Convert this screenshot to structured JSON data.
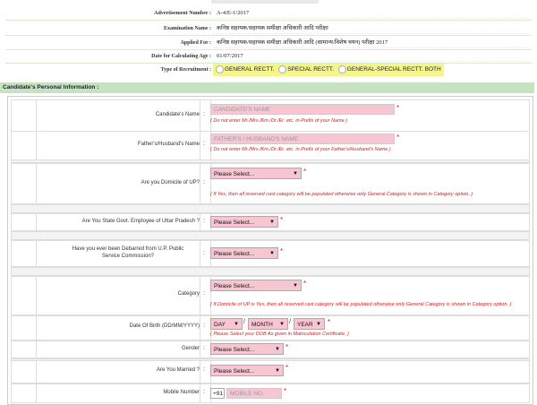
{
  "header": {
    "adv_label": "Advertisement Number :",
    "adv_value": "A-4/E-1/2017",
    "exam_label": "Examination Name :",
    "exam_value": "कनिष्ठ सहायक/सहायक समीक्षा अधिकारी आदि परीक्षा",
    "applied_label": "Applied For :",
    "applied_value": "कनिष्ठ सहायक/सहायक समीक्षा अधिकारी आदि (सामान्य/विशेष चयन) परीक्षा 2017",
    "date_label": "Date for Calculating Age :",
    "date_value": "01/07/2017",
    "recruit_label": "Type of Recruitment :",
    "recruit_options": [
      "GENERAL RECTT.",
      "SPECIAL RECTT.",
      "GENERAL-SPECIAL RECTT. BOTH"
    ]
  },
  "section_title": "Candidate's Personal Information :",
  "form": {
    "name_label": "Candidate's Name",
    "name_placeholder": "CANDIDATE'S NAME",
    "name_note": "( Do not enter Mr./Mrs./Km./Dr./Er. etc. in Prefix of your Name )",
    "father_label": "Father's/Husband's Name",
    "father_placeholder": "FATHER'S / HUSBAND'S NAME",
    "father_note": "( Do not enter Mr./Mrs./Km./Dr./Er. etc. in Prefix of your Father's/Husband's Name )",
    "domicile_label": "Are you Domicile of UP?",
    "domicile_value": "Please Select...",
    "domicile_note": "( If Yes, then all reserved cast category will be populated otherwise only General Category is shown in Category option. )",
    "govt_label": "Are You State Govt. Employee of Uttar Pradesh ?",
    "govt_value": "Please Select...",
    "debarred_label": "Have you ever been Debarred from U.P. Public Service Commission?",
    "debarred_value": "Please Select...",
    "category_label": "Category",
    "category_value": "Please Select...",
    "category_note": "( If Domicile of UP is Yes, then all reserved cast category will be populated otherwise only General Category is shown in Category option. )",
    "dob_label": "Date Of Birth (DD/MM/YYYY)",
    "dob_day": "DAY",
    "dob_month": "MONTH",
    "dob_year": "YEAR",
    "dob_note": "( Please Select your DOB As given in Matriculation Certificate. )",
    "gender_label": "Gender",
    "gender_value": "Please Select...",
    "married_label": "Are You Married ?",
    "married_value": "Please Select...",
    "mobile_label": "Mobile Number",
    "mobile_prefix": "+91",
    "mobile_placeholder": "MOBILE NO.",
    "colon": ":",
    "star": "*",
    "slash": "/"
  }
}
